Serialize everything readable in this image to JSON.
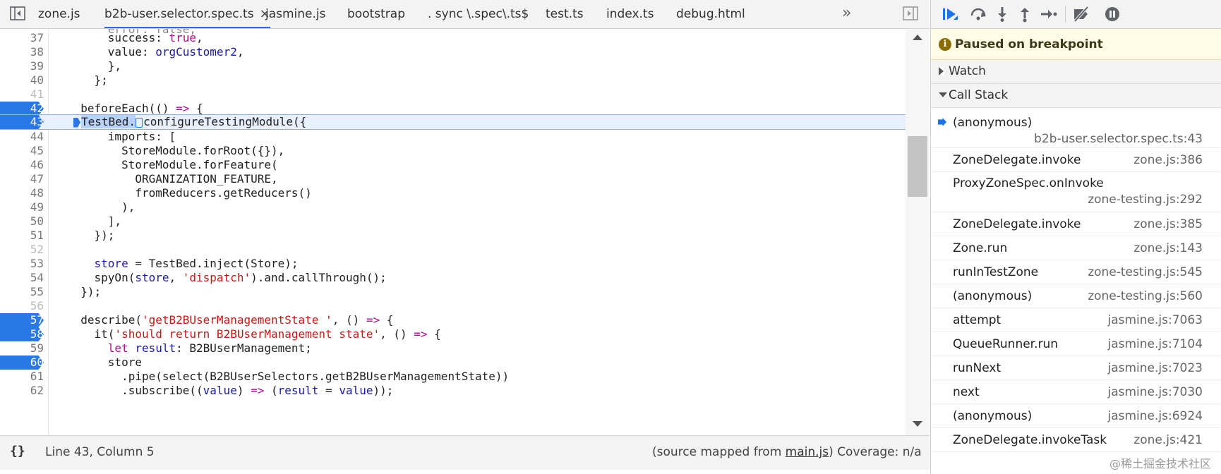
{
  "tabs": [
    {
      "label": "zone.js"
    },
    {
      "label": "b2b-user.selector.spec.ts",
      "close": "×"
    },
    {
      "label": "jasmine.js"
    },
    {
      "label": "bootstrap"
    },
    {
      "label": ". sync \\.spec\\.ts$"
    },
    {
      "label": "test.ts"
    },
    {
      "label": "index.ts"
    },
    {
      "label": "debug.html"
    }
  ],
  "tabs_more": "»",
  "code": {
    "l37": {
      "num": "37"
    },
    "l38": {
      "num": "38"
    },
    "l39": {
      "num": "39",
      "text": "      },"
    },
    "l40": {
      "num": "40",
      "text": "    };"
    },
    "l41": {
      "num": "41"
    },
    "l42": {
      "num": "42"
    },
    "l43": {
      "num": "43"
    },
    "l44": {
      "num": "44",
      "text": "      imports: ["
    },
    "l45": {
      "num": "45",
      "text": "        StoreModule.forRoot({}),"
    },
    "l46": {
      "num": "46",
      "text": "        StoreModule.forFeature("
    },
    "l47": {
      "num": "47",
      "text": "          ORGANIZATION_FEATURE,"
    },
    "l48": {
      "num": "48",
      "text": "          fromReducers.getReducers()"
    },
    "l49": {
      "num": "49",
      "text": "        ),"
    },
    "l50": {
      "num": "50",
      "text": "      ],"
    },
    "l51": {
      "num": "51",
      "text": "    });"
    },
    "l52": {
      "num": "52"
    },
    "l53": {
      "num": "53"
    },
    "l54": {
      "num": "54"
    },
    "l55": {
      "num": "55",
      "text": "  });"
    },
    "l56": {
      "num": "56"
    },
    "l57": {
      "num": "57"
    },
    "l58": {
      "num": "58"
    },
    "l59": {
      "num": "59"
    },
    "l60": {
      "num": "60",
      "text": "      store"
    },
    "l61": {
      "num": "61",
      "text": "        .pipe(select(B2BUserSelectors.getB2BUserManagementState))"
    },
    "l62": {
      "num": "62"
    }
  },
  "status": {
    "braces": "{}",
    "position": "Line 43, Column 5",
    "mapped_prefix": "(source mapped from ",
    "mapped_file": "main.js",
    "mapped_suffix": ")",
    "coverage": "Coverage: n/a"
  },
  "debugger": {
    "paused_label": "Paused on breakpoint",
    "watch_label": "Watch",
    "callstack_label": "Call Stack",
    "frames": [
      {
        "fn": "(anonymous)",
        "loc": "b2b-user.selector.spec.ts:43",
        "current": true
      },
      {
        "fn": "ZoneDelegate.invoke",
        "loc": "zone.js:386"
      },
      {
        "fn": "ProxyZoneSpec.onInvoke",
        "loc": "zone-testing.js:292"
      },
      {
        "fn": "ZoneDelegate.invoke",
        "loc": "zone.js:385"
      },
      {
        "fn": "Zone.run",
        "loc": "zone.js:143"
      },
      {
        "fn": "runInTestZone",
        "loc": "zone-testing.js:545"
      },
      {
        "fn": "(anonymous)",
        "loc": "zone-testing.js:560"
      },
      {
        "fn": "attempt",
        "loc": "jasmine.js:7063"
      },
      {
        "fn": "QueueRunner.run",
        "loc": "jasmine.js:7104"
      },
      {
        "fn": "runNext",
        "loc": "jasmine.js:7023"
      },
      {
        "fn": "next",
        "loc": "jasmine.js:7030"
      },
      {
        "fn": "(anonymous)",
        "loc": "jasmine.js:6924"
      },
      {
        "fn": "ZoneDelegate.invokeTask",
        "loc": "zone.js:421"
      }
    ]
  },
  "watermark": "@稀土掘金技术社区",
  "colors": {
    "accent": "#1a73e8",
    "breakpoint": "#2a77e6",
    "paused_bg": "#fffbe5"
  }
}
